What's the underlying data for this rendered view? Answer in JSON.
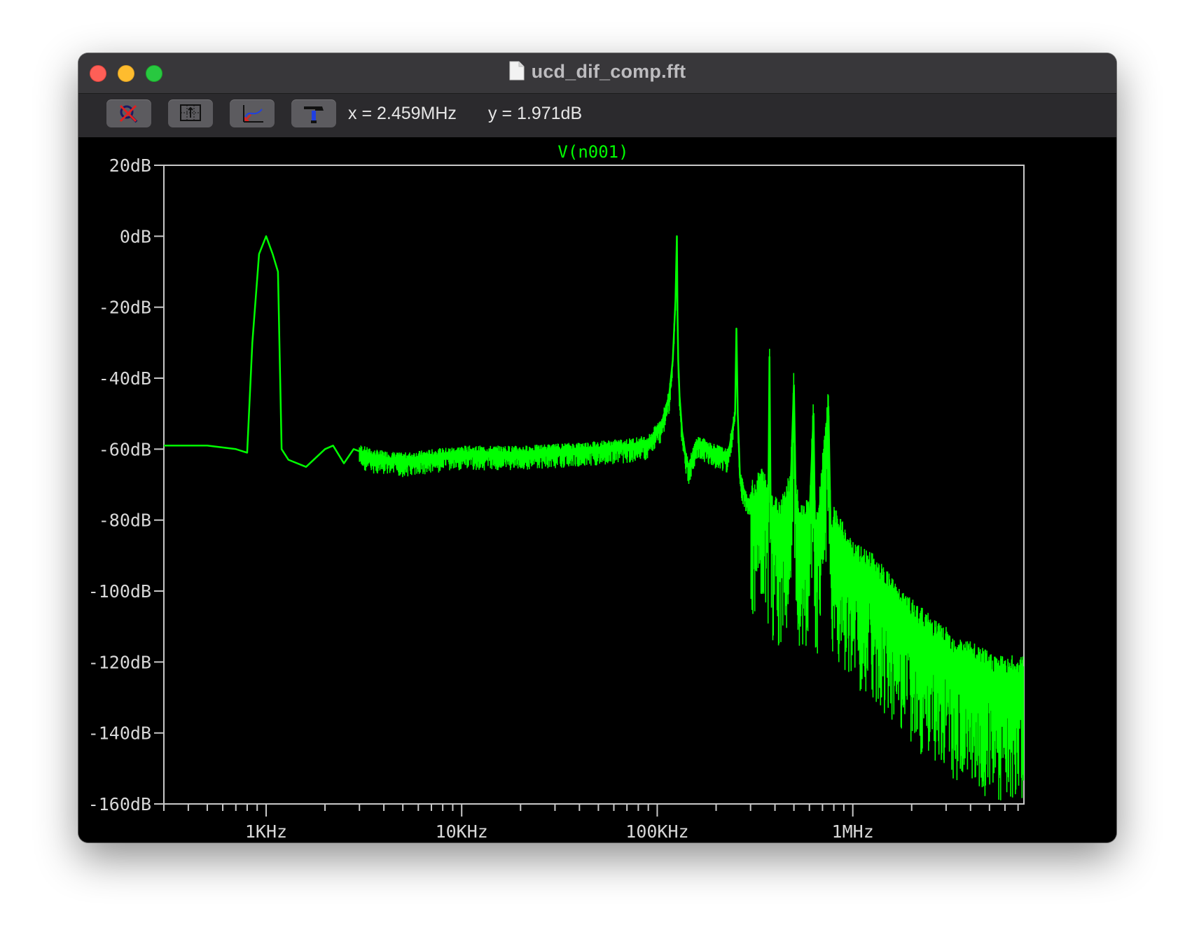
{
  "window": {
    "title": "ucd_dif_comp.fft"
  },
  "toolbar": {
    "buttons": [
      {
        "name": "autorange-button",
        "icon": "magnifier-cross-icon"
      },
      {
        "name": "grid-button",
        "icon": "grid-axes-icon"
      },
      {
        "name": "pan-button",
        "icon": "plot-trace-icon"
      },
      {
        "name": "settings-button",
        "icon": "hammer-icon"
      }
    ],
    "x_readout": "x = 2.459MHz",
    "y_readout": "y = 1.971dB"
  },
  "colors": {
    "trace": "#00ff00",
    "axes": "#c8c8c8",
    "background": "#000000"
  },
  "chart_data": {
    "type": "line",
    "title": "V(n001)",
    "xscale": "log",
    "xlim": [
      300,
      7500000
    ],
    "ylim": [
      -160,
      20
    ],
    "grid": false,
    "x_ticks": [
      {
        "value": 1000,
        "label": "1KHz"
      },
      {
        "value": 10000,
        "label": "10KHz"
      },
      {
        "value": 100000,
        "label": "100KHz"
      },
      {
        "value": 1000000,
        "label": "1MHz"
      }
    ],
    "y_ticks": [
      {
        "value": 20,
        "label": "20dB"
      },
      {
        "value": 0,
        "label": "0dB"
      },
      {
        "value": -20,
        "label": "-20dB"
      },
      {
        "value": -40,
        "label": "-40dB"
      },
      {
        "value": -60,
        "label": "-60dB"
      },
      {
        "value": -80,
        "label": "-80dB"
      },
      {
        "value": -100,
        "label": "-100dB"
      },
      {
        "value": -120,
        "label": "-120dB"
      },
      {
        "value": -140,
        "label": "-140dB"
      },
      {
        "value": -160,
        "label": "-160dB"
      }
    ],
    "series": [
      {
        "name": "V(n001)",
        "x": [
          300,
          500,
          700,
          800,
          850,
          920,
          1000,
          1080,
          1150,
          1200,
          1300,
          1600,
          2000,
          2200,
          2500,
          2800,
          3500,
          5000,
          7000,
          10000,
          20000,
          40000,
          70000,
          90000,
          105000,
          115000,
          120000,
          124000,
          126000,
          127000,
          128000,
          130000,
          134000,
          140000,
          145000,
          160000,
          190000,
          230000,
          250000,
          254000,
          258000,
          265000,
          290000,
          320000,
          340000,
          370000,
          375000,
          380000,
          390000,
          420000,
          480000,
          500000,
          510000,
          530000,
          600000,
          630000,
          640000,
          660000,
          750000,
          770000,
          785000,
          800000,
          900000,
          1000000,
          1250000,
          1500000,
          1800000,
          2200000,
          2700000,
          3300000,
          4000000,
          5000000,
          6000000,
          7500000
        ],
        "y": [
          -59,
          -59,
          -60,
          -61,
          -30,
          -5,
          0,
          -5,
          -10,
          -60,
          -63,
          -65,
          -60,
          -59,
          -64,
          -60,
          -62,
          -63,
          -62,
          -61,
          -61,
          -60,
          -59,
          -58,
          -53,
          -45,
          -35,
          -18,
          0,
          -22,
          -35,
          -45,
          -55,
          -62,
          -65,
          -58,
          -60,
          -62,
          -50,
          -26,
          -50,
          -68,
          -75,
          -74,
          -70,
          -75,
          -34,
          -75,
          -78,
          -80,
          -72,
          -42,
          -72,
          -81,
          -80,
          -50,
          -80,
          -84,
          -48,
          -82,
          -88,
          -82,
          -87,
          -92,
          -95,
          -100,
          -106,
          -110,
          -114,
          -118,
          -120,
          -123,
          -124,
          -124
        ]
      }
    ]
  }
}
